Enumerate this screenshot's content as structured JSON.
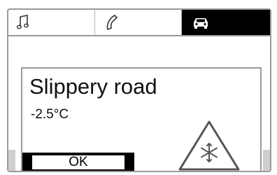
{
  "tabs": [
    {
      "icon": "music-note-icon",
      "selected": false
    },
    {
      "icon": "phone-icon",
      "selected": false
    },
    {
      "icon": "car-icon",
      "selected": true
    }
  ],
  "dialog": {
    "title": "Slippery road",
    "temperature": "-2.5°C",
    "warning_icon": "snowflake-warning-triangle-icon",
    "ok_label": "OK"
  },
  "colors": {
    "selected_tab": "#000000",
    "border": "#9a9a9a",
    "button": "#000000"
  }
}
